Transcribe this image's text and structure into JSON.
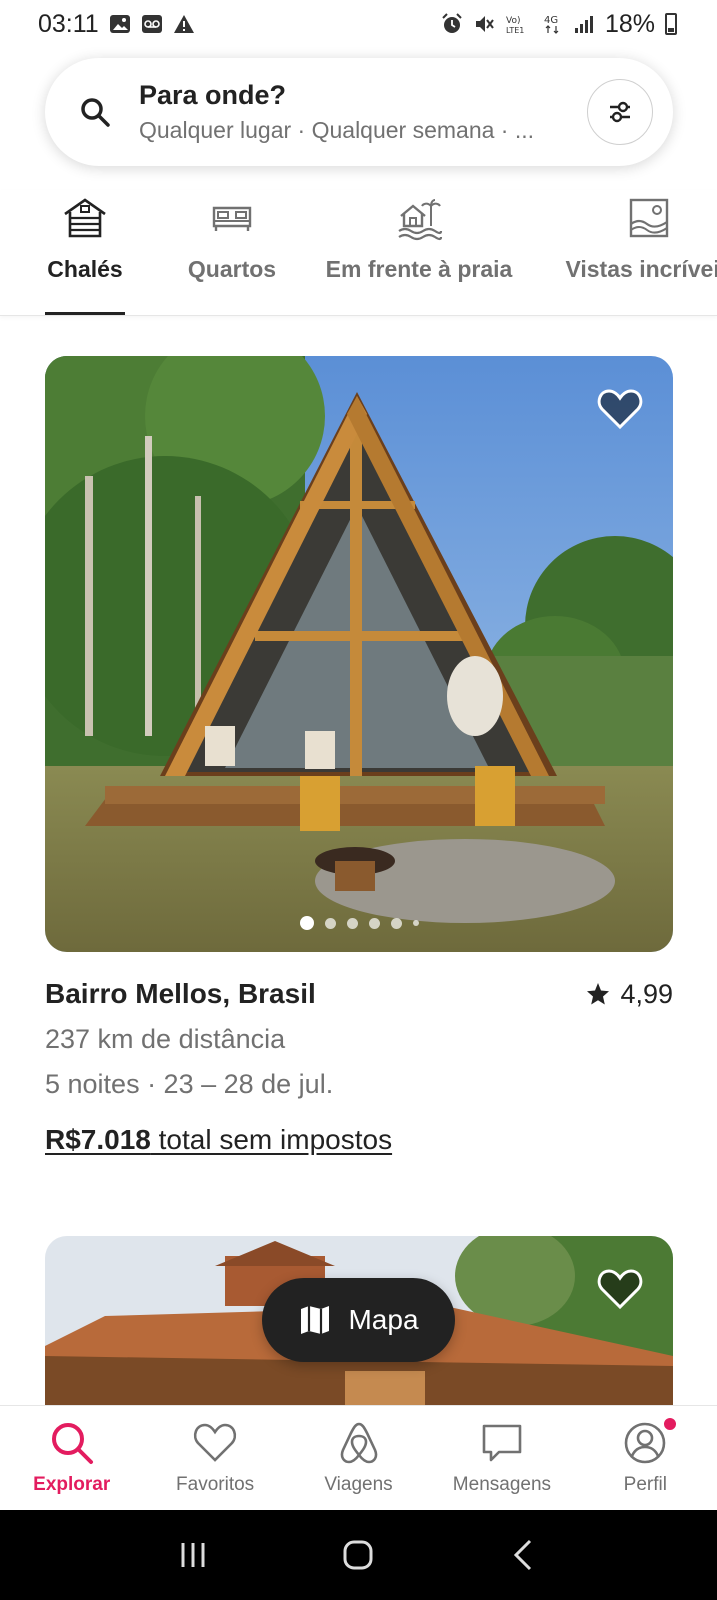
{
  "status_bar": {
    "time": "03:11",
    "battery": "18%",
    "icons": [
      "gallery-icon",
      "voicemail-icon",
      "warning-icon",
      "alarm-icon",
      "mute-icon",
      "volte-icon",
      "4g-icon",
      "signal-icon",
      "battery-icon"
    ]
  },
  "search": {
    "title": "Para onde?",
    "subtitle": "Qualquer lugar · Qualquer semana · ..."
  },
  "categories": [
    {
      "label": "Chalés",
      "icon": "cabin-icon",
      "active": true
    },
    {
      "label": "Quartos",
      "icon": "bed-icon",
      "active": false
    },
    {
      "label": "Em frente à praia",
      "icon": "beachfront-icon",
      "active": false
    },
    {
      "label": "Vistas incríveis",
      "icon": "amazing-views-icon",
      "active": false
    }
  ],
  "listing": {
    "location": "Bairro Mellos, Brasil",
    "rating": "4,99",
    "distance": "237 km de distância",
    "dates": "5 noites · 23 – 28 de jul.",
    "price": "R$7.018",
    "price_suffix": " total sem impostos",
    "photo_count_dots": 6,
    "active_dot": 0
  },
  "map_button": {
    "label": "Mapa"
  },
  "bottom_nav": [
    {
      "label": "Explorar",
      "icon": "search-icon",
      "active": true
    },
    {
      "label": "Favoritos",
      "icon": "heart-icon",
      "active": false
    },
    {
      "label": "Viagens",
      "icon": "airbnb-logo-icon",
      "active": false
    },
    {
      "label": "Mensagens",
      "icon": "message-icon",
      "active": false
    },
    {
      "label": "Perfil",
      "icon": "profile-icon",
      "active": false
    }
  ],
  "colors": {
    "accent": "#E31C5F",
    "text_primary": "#222222",
    "text_secondary": "#717171"
  }
}
